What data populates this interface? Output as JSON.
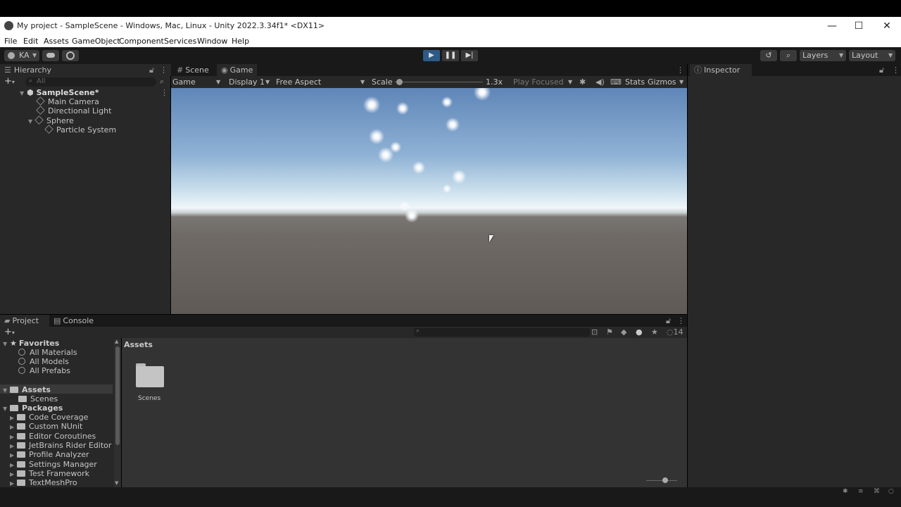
{
  "window": {
    "title": "My project - SampleScene - Windows, Mac, Linux - Unity 2022.3.34f1* <DX11>",
    "controls": [
      "—",
      "☐",
      "✕"
    ]
  },
  "menu": [
    "File",
    "Edit",
    "Assets",
    "GameObject",
    "Component",
    "Services",
    "Window",
    "Help"
  ],
  "toolbar": {
    "account": "KA",
    "layers_label": "Layers",
    "layout_label": "Layout"
  },
  "hierarchy": {
    "tab_label": "Hierarchy",
    "search_placeholder": "All",
    "items": [
      {
        "label": "SampleScene*"
      },
      {
        "label": "Main Camera"
      },
      {
        "label": "Directional Light"
      },
      {
        "label": "Sphere"
      },
      {
        "label": "Particle System"
      }
    ]
  },
  "viewtabs": {
    "scene_label": "Scene",
    "game_label": "Game"
  },
  "gamebar": {
    "mode": "Game",
    "display": "Display 1",
    "aspect": "Free Aspect",
    "scale_label": "Scale",
    "scale_value": "1.3x",
    "scale_fraction": 0.05,
    "play_mode": "Play Focused",
    "stats_label": "Stats",
    "gizmos_label": "Gizmos"
  },
  "inspector": {
    "tab_label": "Inspector"
  },
  "bottomtabs": {
    "project_label": "Project",
    "console_label": "Console"
  },
  "project": {
    "hidden_count": "14",
    "breadcrumb": "Assets",
    "favorites_label": "Favorites",
    "favorites": [
      "All Materials",
      "All Models",
      "All Prefabs"
    ],
    "assets_label": "Assets",
    "assets_children": [
      "Scenes"
    ],
    "packages_label": "Packages",
    "packages": [
      "Code Coverage",
      "Custom NUnit",
      "Editor Coroutines",
      "JetBrains Rider Editor",
      "Profile Analyzer",
      "Settings Manager",
      "Test Framework",
      "TextMeshPro"
    ],
    "grid_items": [
      "Scenes"
    ]
  },
  "colors": {
    "play_active": "#2d5a86",
    "panel_bg": "#282828",
    "toolbar_bg": "#191919"
  }
}
